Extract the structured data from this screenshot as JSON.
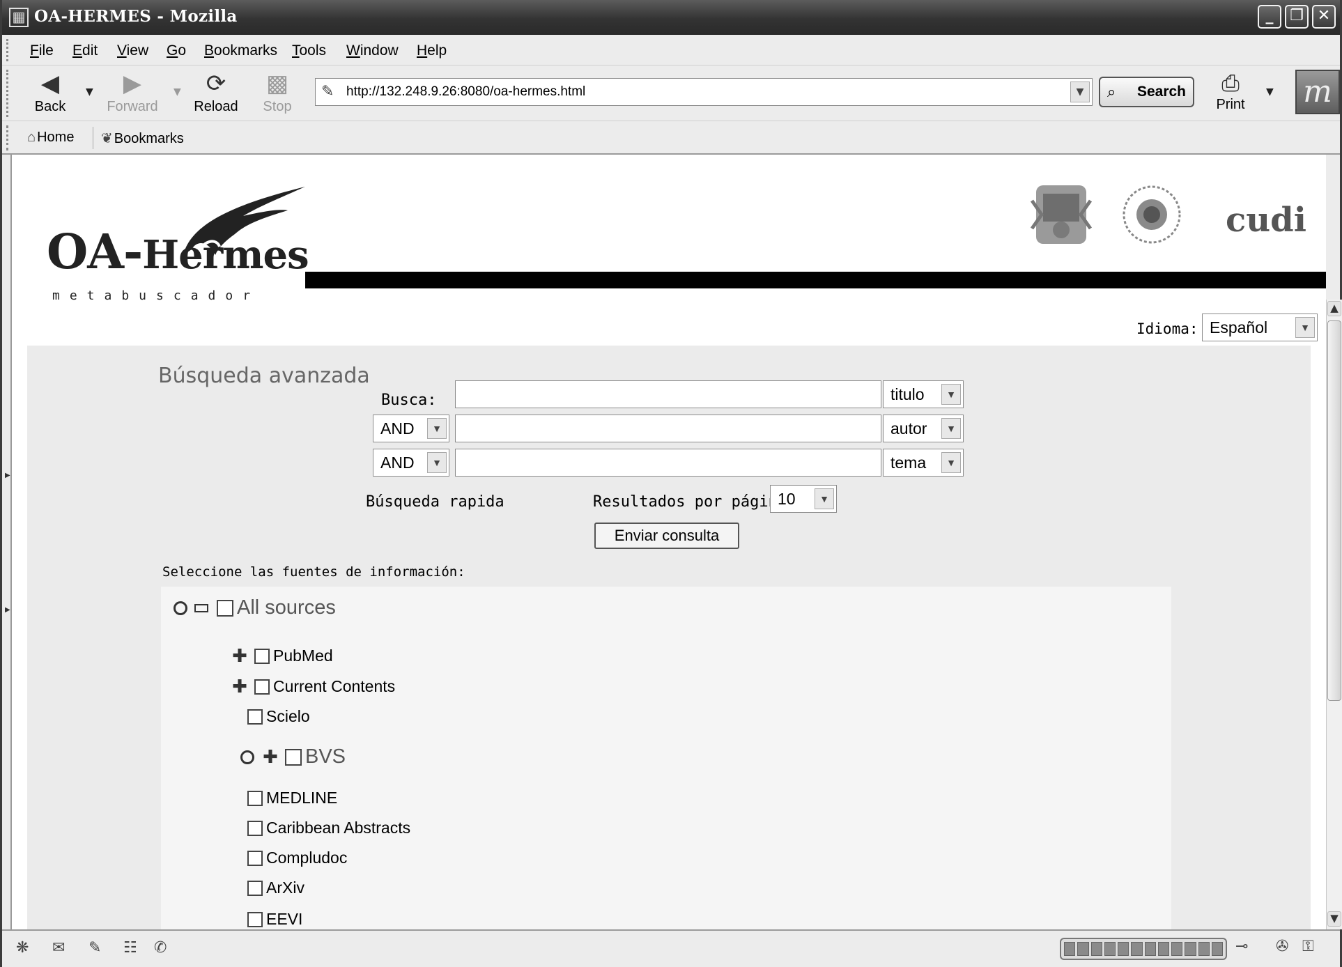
{
  "window": {
    "title": "OA-HERMES - Mozilla"
  },
  "menu": {
    "file": "File",
    "edit": "Edit",
    "view": "View",
    "go": "Go",
    "bookmarks": "Bookmarks",
    "tools": "Tools",
    "window": "Window",
    "help": "Help"
  },
  "nav": {
    "back": "Back",
    "forward": "Forward",
    "reload": "Reload",
    "stop": "Stop",
    "search": "Search",
    "print": "Print"
  },
  "url": "http://132.248.9.26:8080/oa-hermes.html",
  "personal_bar": {
    "home": "Home",
    "bookmarks": "Bookmarks"
  },
  "header": {
    "brand_oa": "OA-",
    "brand_hermes": "Hermes",
    "brand_sub": "metabuscador",
    "partner_cudi": "cudi"
  },
  "language": {
    "label": "Idioma:",
    "selected": "Español"
  },
  "search": {
    "title": "Búsqueda avanzada",
    "busca_label": "Busca:",
    "rows": [
      {
        "operator": "",
        "value": "",
        "field": "titulo"
      },
      {
        "operator": "AND",
        "value": "",
        "field": "autor"
      },
      {
        "operator": "AND",
        "value": "",
        "field": "tema"
      }
    ],
    "quick_search": "Búsqueda rapida",
    "results_label": "Resultados por página:",
    "results_per_page": "10",
    "submit": "Enviar consulta"
  },
  "sources": {
    "label": "Seleccione las fuentes de información:",
    "all": "All sources",
    "pubmed": "PubMed",
    "current_contents": "Current Contents",
    "scielo": "Scielo",
    "bvs": "BVS",
    "medline": "MEDLINE",
    "caribbean": "Caribbean Abstracts",
    "compludoc": "Compludoc",
    "arxiv": "ArXiv",
    "eevi": "EEVI"
  }
}
